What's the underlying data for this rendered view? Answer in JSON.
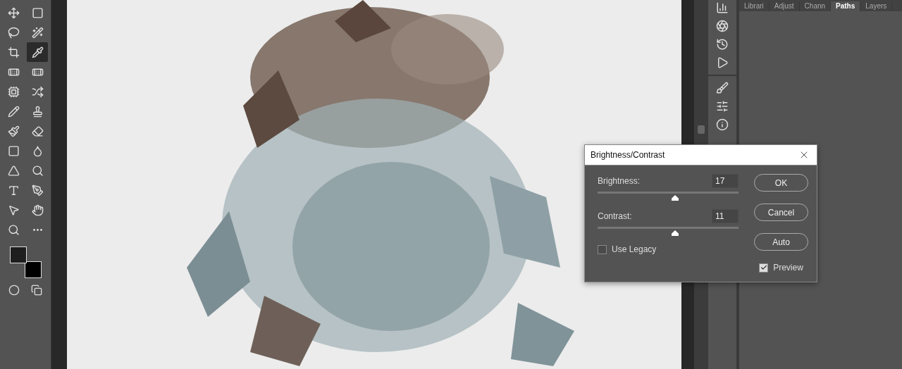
{
  "toolbar": {
    "tools": [
      {
        "selected": false
      },
      {
        "selected": false
      },
      {
        "selected": false
      },
      {
        "selected": false
      },
      {
        "selected": false
      },
      {
        "selected": true
      },
      {
        "selected": false
      },
      {
        "selected": false
      },
      {
        "selected": false
      },
      {
        "selected": false
      },
      {
        "selected": false
      },
      {
        "selected": false
      },
      {
        "selected": false
      },
      {
        "selected": false
      },
      {
        "selected": false
      },
      {
        "selected": false
      },
      {
        "selected": false
      },
      {
        "selected": false
      },
      {
        "selected": false
      },
      {
        "selected": false
      },
      {
        "selected": false
      },
      {
        "selected": false
      },
      {
        "selected": false
      },
      {
        "selected": false
      }
    ]
  },
  "panel": {
    "tabs": [
      {
        "label": "Librari",
        "selected": false
      },
      {
        "label": "Adjust",
        "selected": false
      },
      {
        "label": "Chann",
        "selected": false
      },
      {
        "label": "Paths",
        "selected": true
      },
      {
        "label": "Layers",
        "selected": false
      }
    ]
  },
  "dialog": {
    "title": "Brightness/Contrast",
    "sliders": [
      {
        "label": "Brightness:",
        "value": "17",
        "level": 0.55
      },
      {
        "label": "Contrast:",
        "value": "11",
        "level": 0.55
      }
    ],
    "use_legacy": {
      "label": "Use Legacy",
      "checked": false
    },
    "preview": {
      "label": "Preview",
      "checked": true
    },
    "buttons": [
      "OK",
      "Cancel",
      "Auto"
    ]
  }
}
